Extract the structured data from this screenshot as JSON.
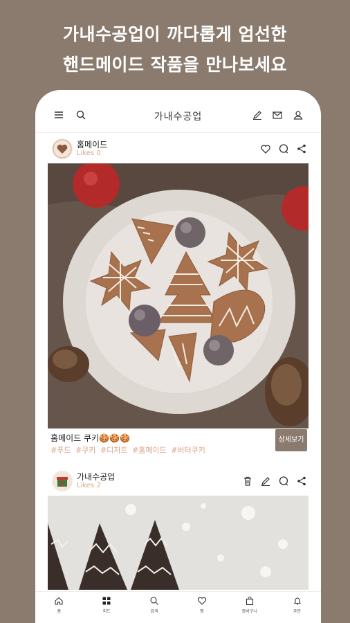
{
  "promo": {
    "line1": "가내수공업이 까다롭게 엄선한",
    "line2": "핸드메이드 작품을 만나보세요"
  },
  "colors": {
    "background": "#8b7b6e",
    "accent": "#d9a48a",
    "button": "#8b7b6e"
  },
  "topbar": {
    "title": "가내수공업",
    "left_icons": [
      "menu-icon",
      "search-icon"
    ],
    "right_icons": [
      "pencil-icon",
      "mail-icon",
      "user-icon"
    ]
  },
  "post1": {
    "username": "홈메이드",
    "likes": "Likes 0",
    "actions": [
      "heart-icon",
      "comment-icon",
      "share-icon"
    ],
    "caption": "홈메이드 쿠키🍪🍪🍪",
    "tags": "#푸드 #쿠키 #디저트 #홈메이드 #버터쿠키",
    "detail_button": "상세보기"
  },
  "post2": {
    "username": "가내수공업",
    "likes": "Likes 2",
    "actions": [
      "trash-icon",
      "pencil-icon",
      "comment-icon",
      "share-icon"
    ]
  },
  "bottomnav": {
    "items": [
      {
        "label": "홈",
        "icon": "home-icon"
      },
      {
        "label": "피드",
        "icon": "grid-icon"
      },
      {
        "label": "검색",
        "icon": "search-icon"
      },
      {
        "label": "찜",
        "icon": "heart-icon"
      },
      {
        "label": "장바구니",
        "icon": "bag-icon"
      },
      {
        "label": "주문",
        "icon": "bell-icon"
      }
    ]
  }
}
